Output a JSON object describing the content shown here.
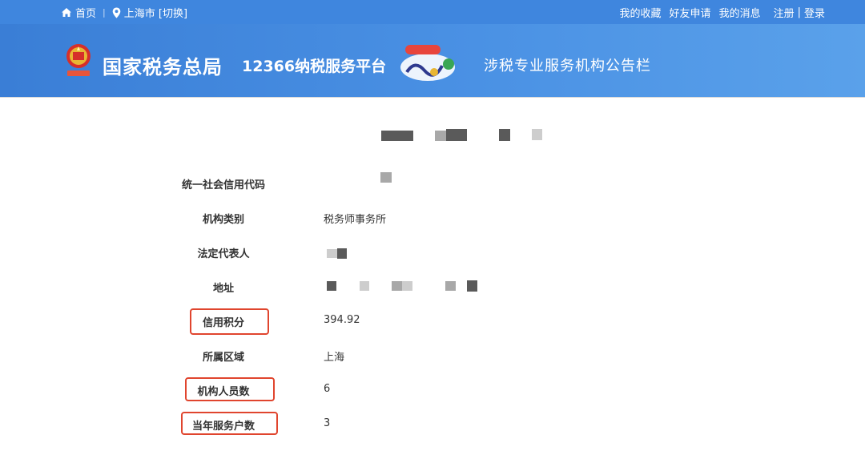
{
  "topbar": {
    "home": "首页",
    "location": "上海市 [切换]",
    "links": [
      "我的收藏",
      "好友申请",
      "我的消息"
    ],
    "register": "注册",
    "divider": "|",
    "login": "登录"
  },
  "header": {
    "site_name": "国家税务总局",
    "platform_name": "12366纳税服务平台",
    "subtitle": "涉税专业服务机构公告栏"
  },
  "details": {
    "rows": [
      {
        "label": "统一社会信用代码",
        "value": ""
      },
      {
        "label": "机构类别",
        "value": "税务师事务所"
      },
      {
        "label": "法定代表人",
        "value": ""
      },
      {
        "label": "地址",
        "value": ""
      },
      {
        "label": "信用积分",
        "value": "394.92"
      },
      {
        "label": "所属区域",
        "value": "上海"
      },
      {
        "label": "机构人员数",
        "value": "6"
      },
      {
        "label": "当年服务户数",
        "value": "3"
      }
    ]
  },
  "colors": {
    "topbar": "#3f86de",
    "banner": "#4a91e4",
    "highlight_border": "#e0452e"
  }
}
